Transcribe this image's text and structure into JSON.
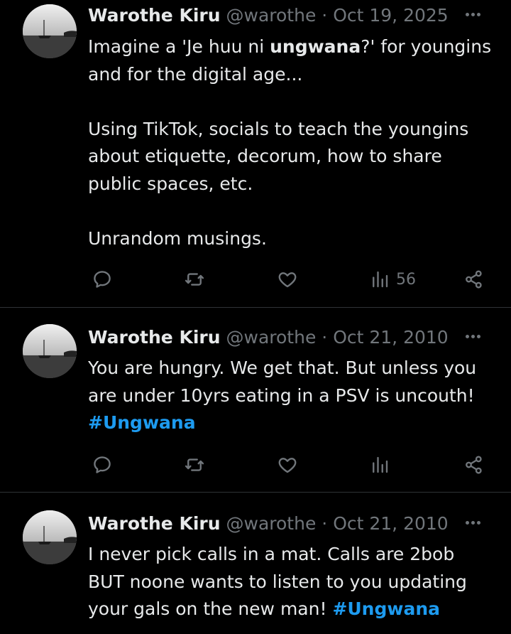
{
  "icons": {
    "reply": "reply-icon",
    "retweet": "retweet-icon",
    "like": "heart-icon",
    "views": "views-icon",
    "share": "share-icon",
    "more": "more-icon"
  },
  "colors": {
    "background": "#000000",
    "text": "#e7e9ea",
    "muted": "#71767b",
    "hashtag": "#1d9bf0",
    "divider": "#2f3336"
  },
  "tweets": [
    {
      "name": "Warothe Kiru",
      "handle": "@warothe",
      "separator": "·",
      "date": "Oct 19, 2025",
      "text": {
        "p1_a": "Imagine a 'Je huu ni ",
        "p1_b": "ungwana",
        "p1_c": "?' for youngins and for the digital age...",
        "p2": "Using TikTok, socials to teach the youngins about etiquette, decorum, how to share public spaces, etc.",
        "p3": "Unrandom musings."
      },
      "views": "56"
    },
    {
      "name": "Warothe Kiru",
      "handle": "@warothe",
      "separator": "·",
      "date": "Oct 21, 2010",
      "text": {
        "body": "You are hungry. We get that. But unless you are under 10yrs eating in a PSV is uncouth! ",
        "hashtag": "#Ungwana"
      }
    },
    {
      "name": "Warothe Kiru",
      "handle": "@warothe",
      "separator": "·",
      "date": "Oct 21, 2010",
      "text": {
        "body": "I never pick calls in a mat. Calls are 2bob BUT noone wants to listen to you updating your gals on the new man! ",
        "hashtag": "#Ungwana"
      }
    }
  ]
}
